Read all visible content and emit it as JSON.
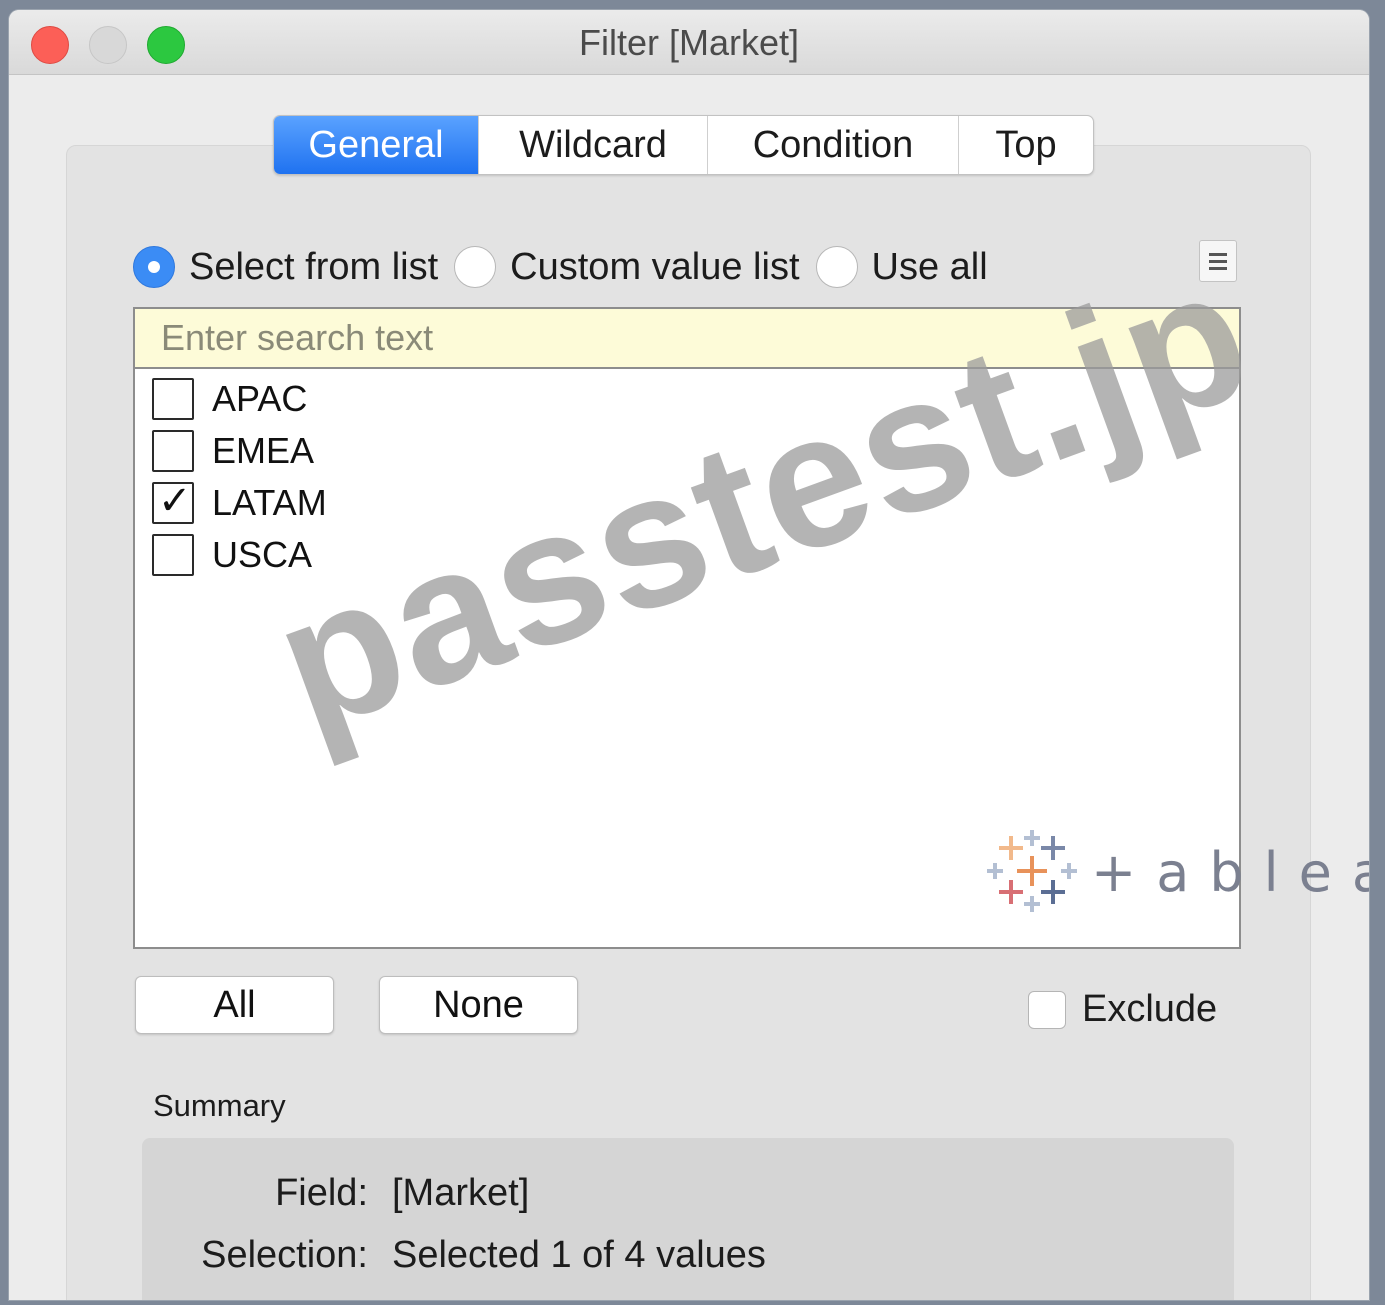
{
  "window": {
    "title": "Filter [Market]"
  },
  "tabs": [
    {
      "label": "General",
      "active": true
    },
    {
      "label": "Wildcard",
      "active": false
    },
    {
      "label": "Condition",
      "active": false
    },
    {
      "label": "Top",
      "active": false
    }
  ],
  "mode_options": [
    {
      "label": "Select from list",
      "selected": true
    },
    {
      "label": "Custom value list",
      "selected": false
    },
    {
      "label": "Use all",
      "selected": false
    }
  ],
  "list_menu_icon": "list-menu-icon",
  "search": {
    "placeholder": "Enter search text",
    "value": ""
  },
  "items": [
    {
      "label": "APAC",
      "checked": false
    },
    {
      "label": "EMEA",
      "checked": false
    },
    {
      "label": "LATAM",
      "checked": true
    },
    {
      "label": "USCA",
      "checked": false
    }
  ],
  "buttons": {
    "all": "All",
    "none": "None"
  },
  "exclude": {
    "label": "Exclude",
    "checked": false
  },
  "summary": {
    "title": "Summary",
    "field_key": "Field:",
    "field_value": "[Market]",
    "selection_key": "Selection:",
    "selection_value": "Selected 1 of 4 values"
  },
  "watermark": "passtest.jp",
  "logo": {
    "text": "+ableau",
    "icon": "tableau-logo-icon"
  },
  "colors": {
    "tab_active": "#1f72f0",
    "search_bg": "#fdfbd8",
    "radio_on": "#3b8cf5"
  }
}
